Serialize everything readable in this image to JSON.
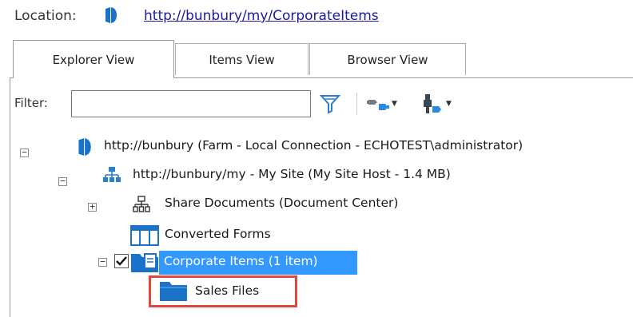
{
  "location": {
    "label": "Location:",
    "url": "http://bunbury/my/CorporateItems"
  },
  "tabs": [
    {
      "label": "Explorer View",
      "active": true
    },
    {
      "label": "Items View",
      "active": false
    },
    {
      "label": "Browser View",
      "active": false
    }
  ],
  "filter": {
    "label": "Filter:",
    "value": "",
    "placeholder": ""
  },
  "toolbar": {
    "icons": [
      "funnel-icon",
      "connect-plug-icon",
      "disconnect-plug-icon"
    ]
  },
  "tree": {
    "farm": "http://bunbury (Farm - Local Connection - ECHOTEST\\administrator)",
    "mysite": "http://bunbury/my - My Site (My Site Host - 1.4 MB)",
    "share_docs": "Share Documents (Document Center)",
    "converted_forms": "Converted Forms",
    "corporate_items": "Corporate Items (1 item)",
    "sales_files": "Sales Files"
  },
  "colors": {
    "selection": "#3399ff",
    "link": "#1a1aa6",
    "highlight_box": "#e0463b",
    "icon_blue": "#1a73c9"
  }
}
